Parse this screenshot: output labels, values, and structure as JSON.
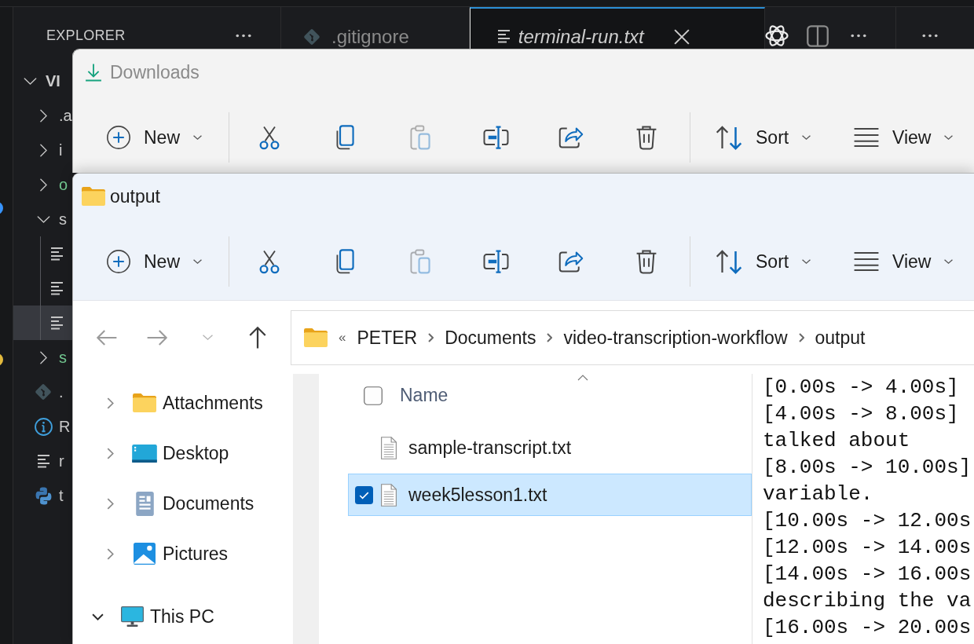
{
  "vscode": {
    "activity_badges": [
      {
        "color": "#3794ff"
      },
      {
        "color": "#e2b93d"
      }
    ],
    "explorer": {
      "title": "EXPLORER",
      "tree": [
        {
          "label": "VI",
          "kind": "folder",
          "expanded": true,
          "selected": false,
          "children": [
            {
              "label": ".a",
              "kind": "folder",
              "expanded": false,
              "selected": false
            },
            {
              "label": "i",
              "kind": "folder",
              "expanded": false,
              "selected": false
            },
            {
              "label": "o",
              "kind": "folder",
              "expanded": false,
              "selected": false,
              "color": "#73c991"
            },
            {
              "label": "s",
              "kind": "folder",
              "expanded": true,
              "selected": false,
              "children": [
                {
                  "kind": "text-file",
                  "selected": false
                },
                {
                  "kind": "text-file",
                  "selected": false
                },
                {
                  "kind": "text-file",
                  "selected": true
                }
              ]
            },
            {
              "label": "s",
              "kind": "folder",
              "expanded": false,
              "selected": false,
              "color": "#73c991"
            },
            {
              "label": ".",
              "kind": "git",
              "selected": false
            },
            {
              "label": "R",
              "kind": "info",
              "selected": false
            },
            {
              "label": "r",
              "kind": "text-file",
              "selected": false
            },
            {
              "label": "t",
              "kind": "python",
              "selected": false
            }
          ]
        }
      ]
    },
    "tabs": [
      {
        "label": ".gitignore",
        "kind": "git",
        "selected": false,
        "preview": false
      },
      {
        "label": "terminal-run.txt",
        "kind": "text-file",
        "selected": true,
        "preview": true
      }
    ]
  },
  "downloads_window": {
    "kind": "download",
    "title": "Downloads",
    "active": false,
    "toolbar": [
      {
        "items": [
          {
            "kind": "new",
            "label": "New",
            "dropdown": true,
            "disabled": false
          }
        ]
      },
      {
        "items": [
          {
            "kind": "cut",
            "dropdown": false,
            "disabled": false
          },
          {
            "kind": "copy",
            "dropdown": false,
            "disabled": false
          },
          {
            "kind": "paste",
            "dropdown": false,
            "disabled": true
          },
          {
            "kind": "rename",
            "dropdown": false,
            "disabled": false
          },
          {
            "kind": "share",
            "dropdown": false,
            "disabled": false
          },
          {
            "kind": "delete",
            "dropdown": false,
            "disabled": false
          }
        ]
      },
      {
        "items": [
          {
            "kind": "sort",
            "label": "Sort",
            "dropdown": true,
            "disabled": false
          },
          {
            "kind": "view",
            "label": "View",
            "dropdown": true,
            "disabled": false
          }
        ]
      }
    ]
  },
  "output_window": {
    "kind": "folder",
    "title": "output",
    "active": true,
    "toolbar": [
      {
        "items": [
          {
            "kind": "new",
            "label": "New",
            "dropdown": true,
            "disabled": false
          }
        ]
      },
      {
        "items": [
          {
            "kind": "cut",
            "dropdown": false,
            "disabled": false
          },
          {
            "kind": "copy",
            "dropdown": false,
            "disabled": false
          },
          {
            "kind": "paste",
            "dropdown": false,
            "disabled": true
          },
          {
            "kind": "rename",
            "dropdown": false,
            "disabled": false
          },
          {
            "kind": "share",
            "dropdown": false,
            "disabled": false
          },
          {
            "kind": "delete",
            "dropdown": false,
            "disabled": false
          }
        ]
      },
      {
        "items": [
          {
            "kind": "sort",
            "label": "Sort",
            "dropdown": true,
            "disabled": false
          },
          {
            "kind": "view",
            "label": "View",
            "dropdown": true,
            "disabled": false
          }
        ]
      }
    ],
    "nav_buttons": [
      {
        "kind": "back",
        "disabled": true
      },
      {
        "kind": "forward",
        "disabled": true
      },
      {
        "kind": "recent",
        "disabled": true
      },
      {
        "kind": "up",
        "disabled": false
      }
    ],
    "address": {
      "overflow": "«",
      "crumbs": [
        "PETER",
        "Documents",
        "video-transcription-workflow",
        "output"
      ]
    },
    "nav_pane": {
      "sections": [
        {
          "items": [
            {
              "label": "Attachments",
              "kind": "folder",
              "expanded": false,
              "selected": false
            },
            {
              "label": "Desktop",
              "kind": "desktop",
              "expanded": false,
              "selected": false
            },
            {
              "label": "Documents",
              "kind": "documents",
              "expanded": false,
              "selected": false
            },
            {
              "label": "Pictures",
              "kind": "pictures",
              "expanded": false,
              "selected": false
            }
          ]
        },
        {
          "items": [
            {
              "label": "This PC",
              "kind": "pc",
              "expanded": true,
              "selected": false
            }
          ]
        }
      ]
    },
    "files": {
      "header": {
        "label": "Name",
        "checked": false,
        "sorted": true
      },
      "rows": [
        {
          "name": "sample-transcript.txt",
          "selected": false
        },
        {
          "name": "week5lesson1.txt",
          "selected": true
        }
      ]
    },
    "preview": {
      "lines": [
        "[0.00s -> 4.00s]",
        "[4.00s -> 8.00s]",
        "talked about",
        "[8.00s -> 10.00s]",
        "variable.",
        "[10.00s -> 12.00s",
        "[12.00s -> 14.00s",
        "[14.00s -> 16.00s",
        "describing the va",
        "[16.00s -> 20.00s"
      ]
    }
  }
}
